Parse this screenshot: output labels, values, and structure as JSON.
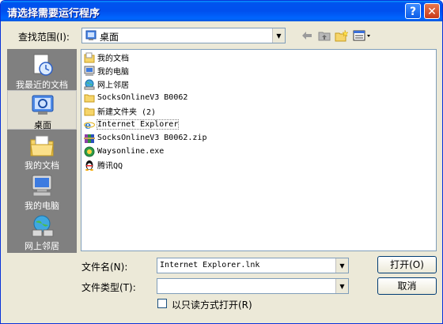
{
  "window": {
    "title": "请选择需要运行程序",
    "help_glyph": "?",
    "close_glyph": "✕"
  },
  "lookin": {
    "label": "查找范围(I):",
    "value": "桌面",
    "icon": "desktop-icon"
  },
  "toolbar": {
    "icons": [
      "back-arrow-icon",
      "up-folder-icon",
      "new-folder-icon",
      "view-menu-icon"
    ]
  },
  "places": [
    {
      "label": "我最近的文档",
      "icon": "recent-documents-icon"
    },
    {
      "label": "桌面",
      "icon": "desktop-icon",
      "selected": true
    },
    {
      "label": "我的文档",
      "icon": "my-documents-icon"
    },
    {
      "label": "我的电脑",
      "icon": "my-computer-icon"
    },
    {
      "label": "网上邻居",
      "icon": "network-places-icon"
    }
  ],
  "files": [
    {
      "name": "我的文档",
      "icon": "my-documents-icon"
    },
    {
      "name": "我的电脑",
      "icon": "my-computer-icon"
    },
    {
      "name": "网上邻居",
      "icon": "network-places-icon"
    },
    {
      "name": "SocksOnlineV3 B0062",
      "icon": "folder-icon"
    },
    {
      "name": "新建文件夹 (2)",
      "icon": "folder-icon"
    },
    {
      "name": "Internet Explorer",
      "icon": "internet-explorer-icon",
      "selected": true
    },
    {
      "name": "SocksOnlineV3 B0062.zip",
      "icon": "winrar-archive-icon"
    },
    {
      "name": "Waysonline.exe",
      "icon": "waysonline-exe-icon"
    },
    {
      "name": "腾讯QQ",
      "icon": "qq-penguin-icon"
    }
  ],
  "filename": {
    "label": "文件名(N):",
    "value": "Internet Explorer.lnk"
  },
  "filetype": {
    "label": "文件类型(T):",
    "value": ""
  },
  "readonly": {
    "label": "以只读方式打开(R)",
    "checked": false
  },
  "buttons": {
    "open": "打开(O)",
    "cancel": "取消"
  },
  "colors": {
    "titlebar": "#0053ee",
    "dialog_bg": "#ece9d8",
    "places_bg": "#808080"
  }
}
